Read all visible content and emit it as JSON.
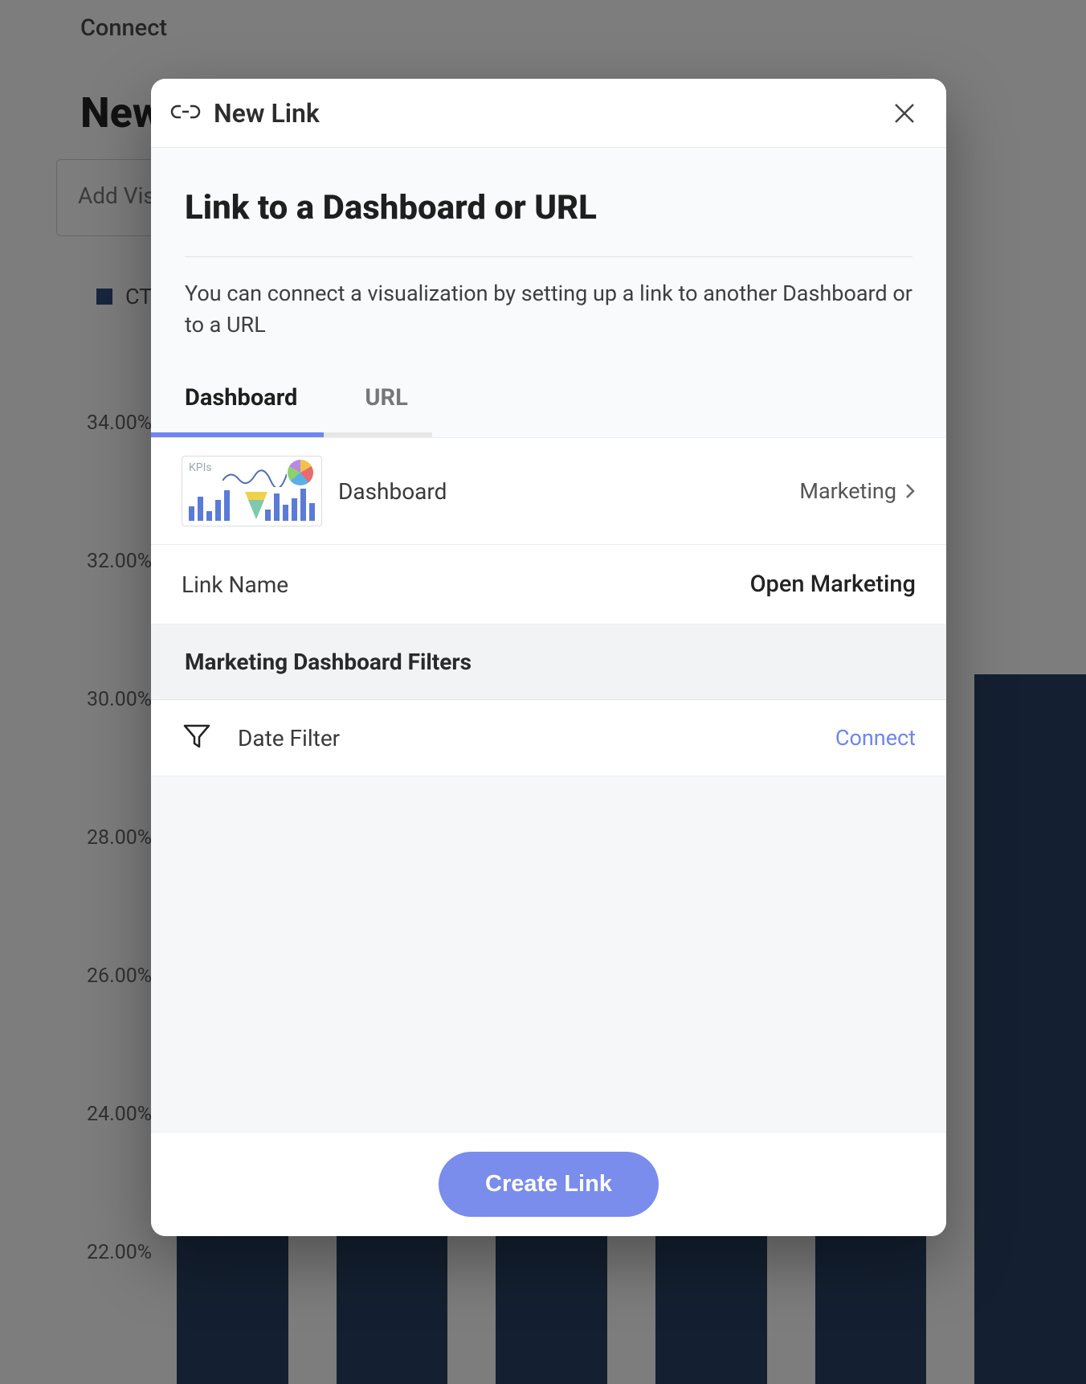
{
  "background": {
    "breadcrumb": "Connect",
    "page_title_fragment": "New",
    "add_vis_fragment": "Add Vis",
    "legend_fragment": "CT",
    "y_ticks": [
      "34.00%",
      "32.00%",
      "30.00%",
      "28.00%",
      "26.00%",
      "24.00%",
      "22.00%"
    ]
  },
  "modal": {
    "header_title": "New Link",
    "title": "Link to a Dashboard or URL",
    "description": "You can connect a visualization by setting up a link to another Dashboard or to a URL",
    "tabs": {
      "dashboard": "Dashboard",
      "url": "URL",
      "active": "dashboard"
    },
    "dashboard_row": {
      "label": "Dashboard",
      "value": "Marketing"
    },
    "link_name_row": {
      "label": "Link Name",
      "value": "Open Marketing"
    },
    "filters_section_title": "Marketing Dashboard Filters",
    "filter_row": {
      "label": "Date Filter",
      "action": "Connect"
    },
    "create_button": "Create Link"
  }
}
